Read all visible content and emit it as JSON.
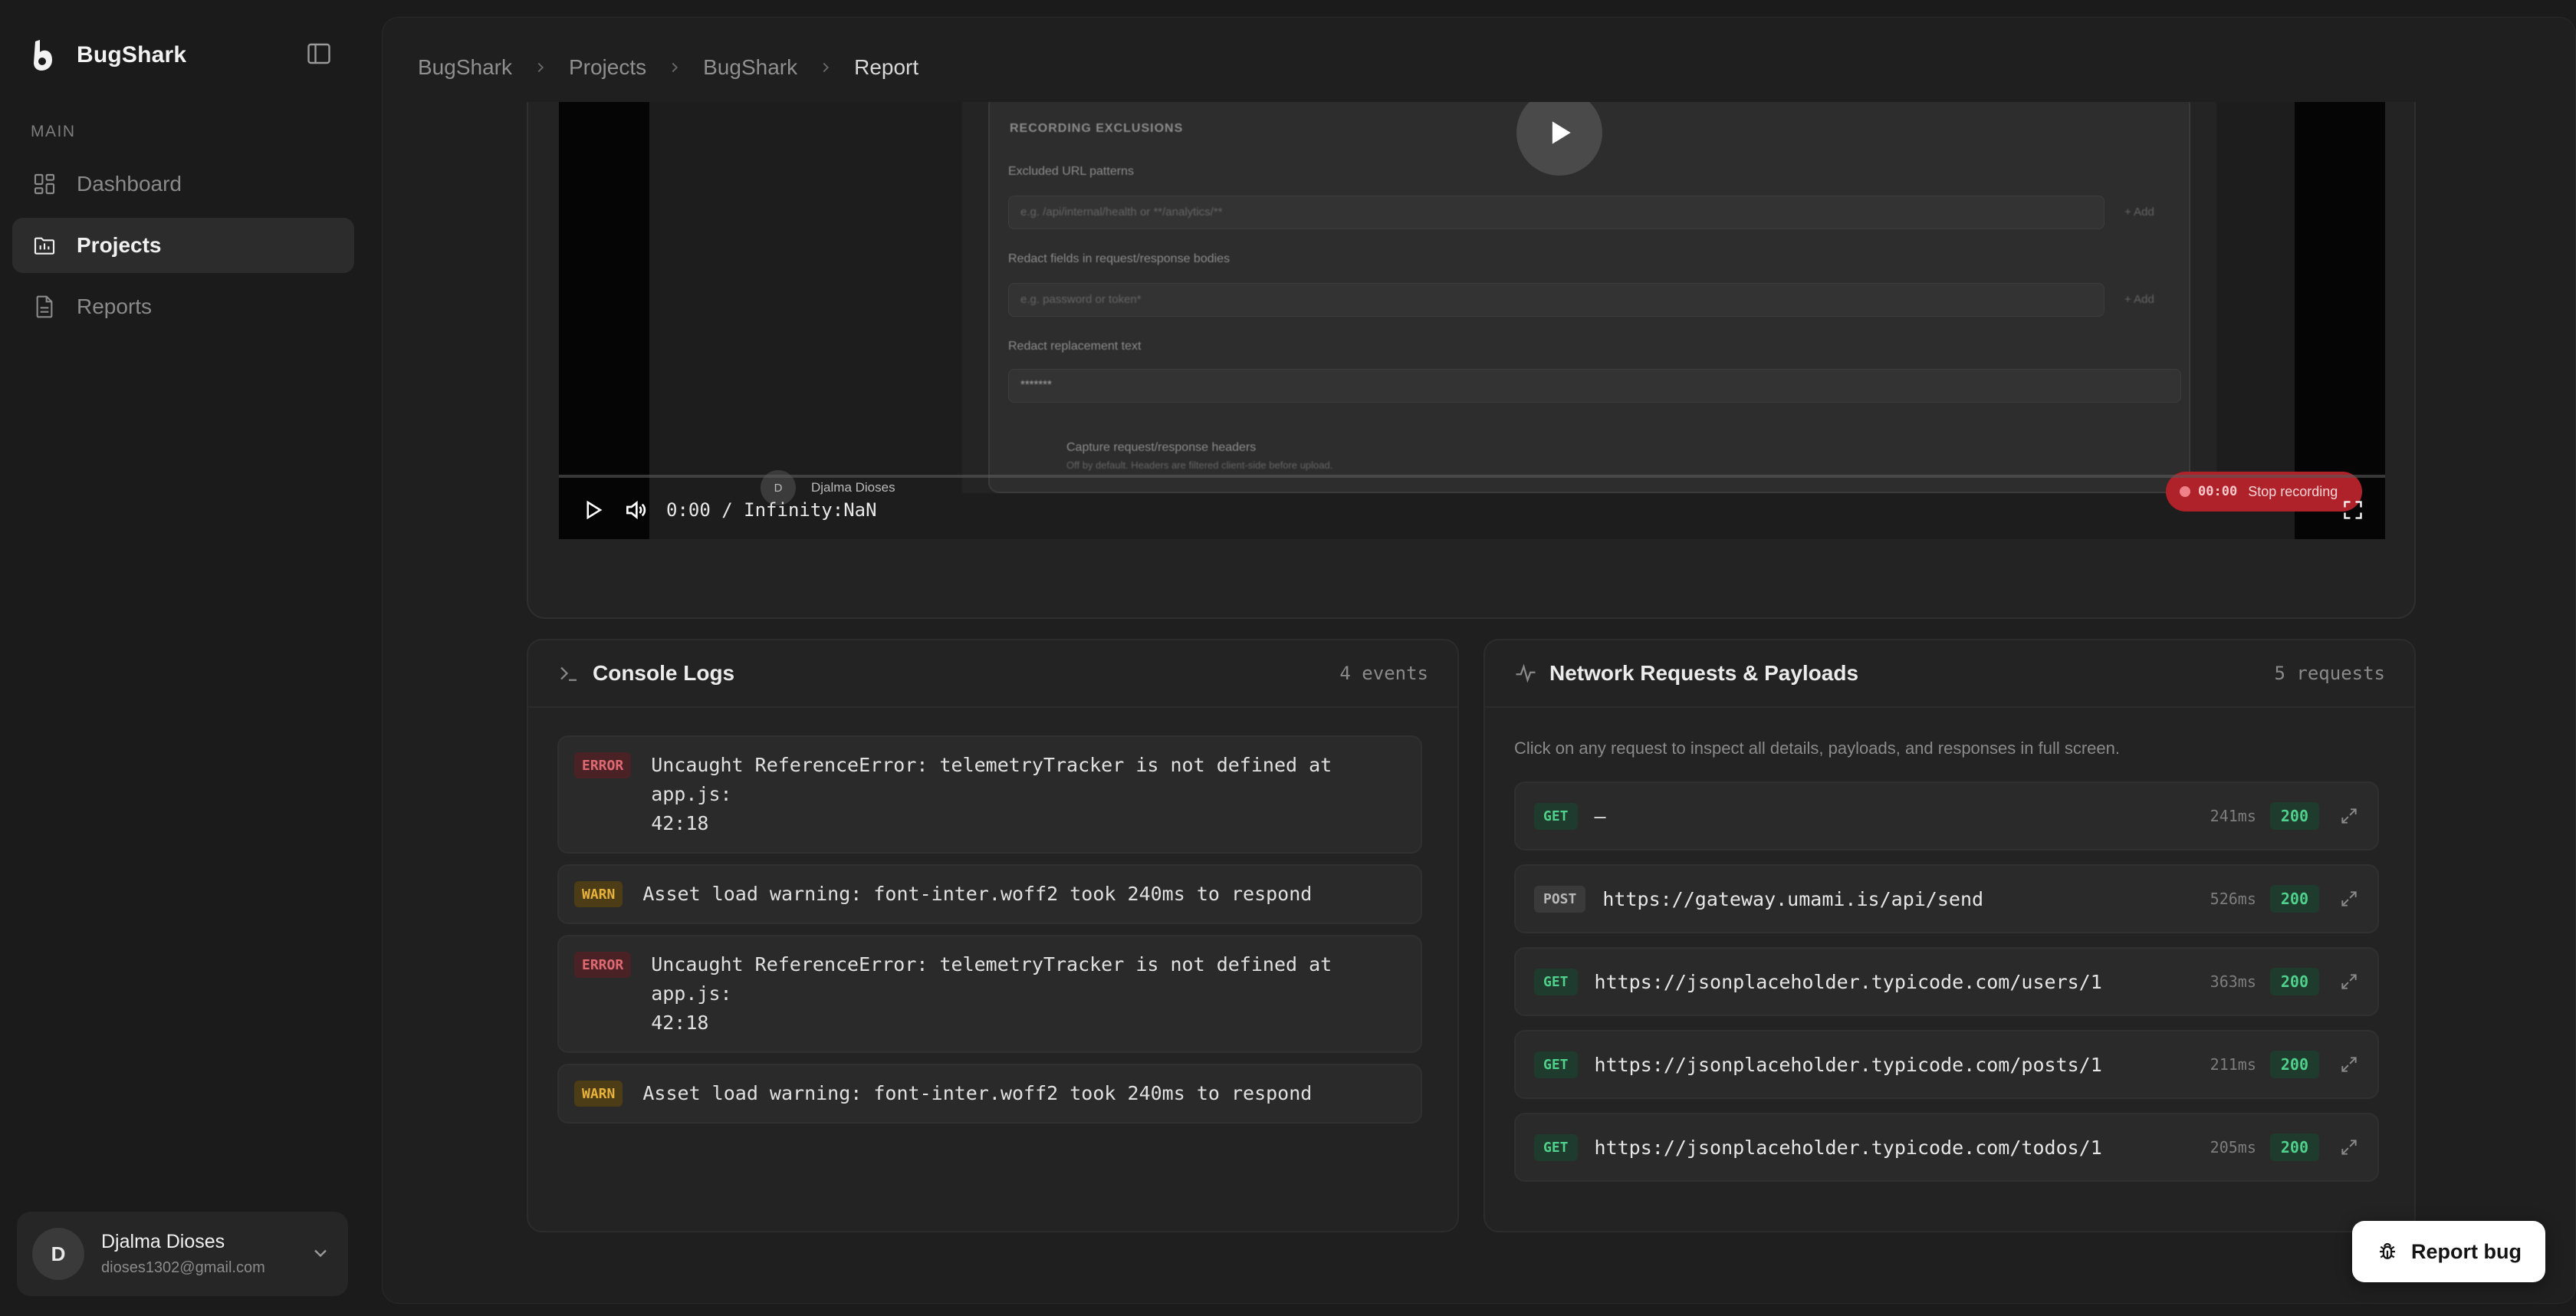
{
  "app": {
    "name": "BugShark"
  },
  "sidebar": {
    "section_label": "MAIN",
    "items": [
      {
        "label": "Dashboard",
        "icon": "dashboard-icon",
        "active": false
      },
      {
        "label": "Projects",
        "icon": "projects-icon",
        "active": true
      },
      {
        "label": "Reports",
        "icon": "reports-icon",
        "active": false
      }
    ],
    "user": {
      "initial": "D",
      "name": "Djalma Dioses",
      "email": "dioses1302@gmail.com"
    }
  },
  "breadcrumb": [
    "BugShark",
    "Projects",
    "BugShark",
    "Report"
  ],
  "video": {
    "time_display": "0:00 / Infinity:NaN",
    "overlay_user_initial": "D",
    "overlay_user_name": "Djalma Dioses",
    "recording_time": "00:00",
    "recording_label": "Stop recording",
    "blurred": {
      "section_title": "RECORDING EXCLUSIONS",
      "field1_label": "Excluded URL patterns",
      "field1_placeholder": "e.g. /api/internal/health or **/analytics/**",
      "field1_button": "+ Add",
      "field2_label": "Redact fields in request/response bodies",
      "field2_placeholder": "e.g. password or token*",
      "field2_button": "+ Add",
      "field3_label": "Redact replacement text",
      "field3_value": "*******",
      "toggle_label": "Capture request/response headers",
      "toggle_sub": "Off by default. Headers are filtered client-side before upload."
    }
  },
  "console": {
    "title": "Console Logs",
    "count": "4 events",
    "logs": [
      {
        "level": "ERROR",
        "message": "Uncaught ReferenceError: telemetryTracker is not defined at app.js:",
        "message2": "42:18"
      },
      {
        "level": "WARN",
        "message": "Asset load warning: font-inter.woff2 took 240ms to respond",
        "message2": ""
      },
      {
        "level": "ERROR",
        "message": "Uncaught ReferenceError: telemetryTracker is not defined at app.js:",
        "message2": "42:18"
      },
      {
        "level": "WARN",
        "message": "Asset load warning: font-inter.woff2 took 240ms to respond",
        "message2": ""
      }
    ]
  },
  "network": {
    "title": "Network Requests & Payloads",
    "count": "5 requests",
    "hint": "Click on any request to inspect all details, payloads, and responses in full screen.",
    "requests": [
      {
        "method": "GET",
        "url": "–",
        "time": "241ms",
        "status": "200"
      },
      {
        "method": "POST",
        "url": "https://gateway.umami.is/api/send",
        "time": "526ms",
        "status": "200"
      },
      {
        "method": "GET",
        "url": "https://jsonplaceholder.typicode.com/users/1",
        "time": "363ms",
        "status": "200"
      },
      {
        "method": "GET",
        "url": "https://jsonplaceholder.typicode.com/posts/1",
        "time": "211ms",
        "status": "200"
      },
      {
        "method": "GET",
        "url": "https://jsonplaceholder.typicode.com/todos/1",
        "time": "205ms",
        "status": "200"
      }
    ]
  },
  "report_bug": {
    "label": "Report bug"
  },
  "colors": {
    "error": "#e06a72",
    "warn": "#e9b23a",
    "success": "#4fd08b",
    "recording": "#b0222a"
  }
}
